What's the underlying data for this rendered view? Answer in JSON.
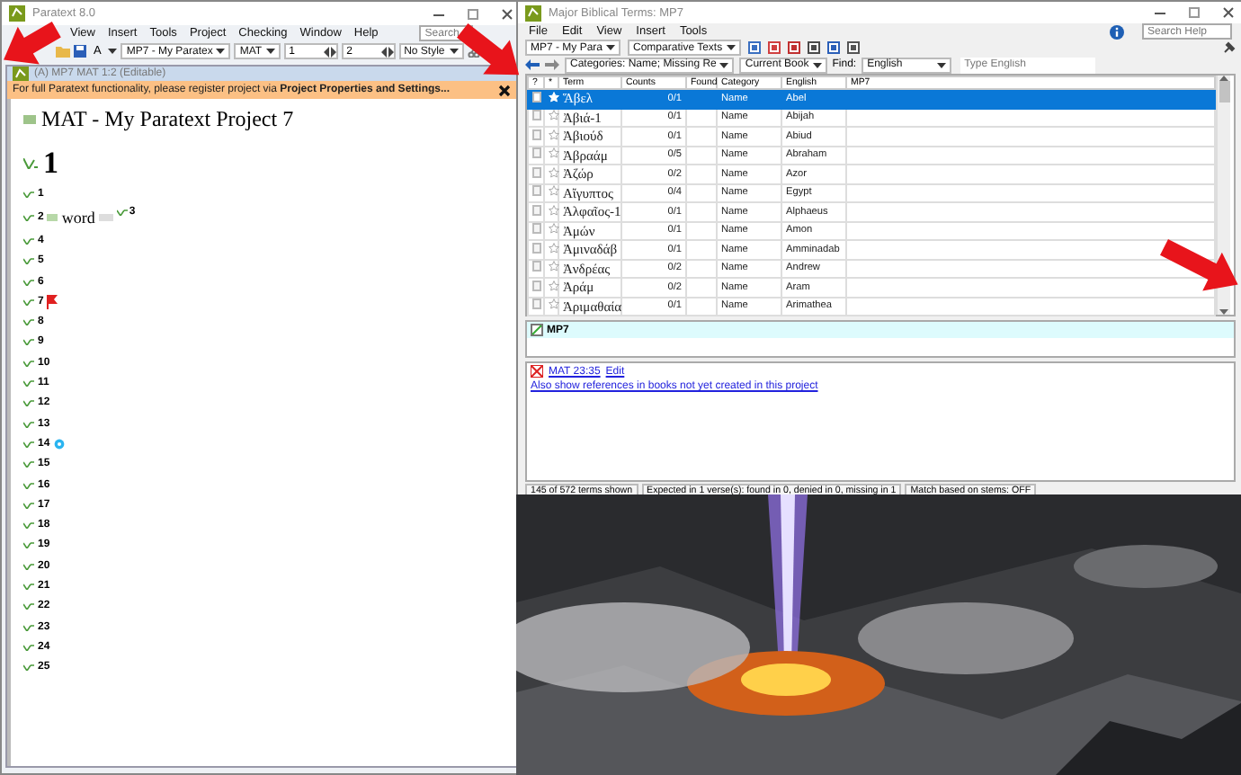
{
  "editor_window": {
    "title": "Paratext 8.0",
    "menu": [
      "View",
      "Insert",
      "Tools",
      "Project",
      "Checking",
      "Window",
      "Help"
    ],
    "search": {
      "placeholder": "Search"
    },
    "toolbar": {
      "style_button": "A",
      "project": "MP7 - My Paratex",
      "book": "MAT",
      "chapter": "1",
      "verse": "2",
      "style": "No Style"
    },
    "document": {
      "title": "(A) MP7 MAT 1:2 (Editable)",
      "banner": "For full Paratext functionality, please register project via **Project Properties and Settings...**",
      "heading": "MAT - My Paratext Project 7",
      "chapter": "1",
      "verses": [
        {
          "number": "1"
        },
        {
          "number": "2",
          "text": "word"
        },
        {
          "number": "3",
          "continues": true
        },
        {
          "number": "4"
        },
        {
          "number": "5"
        },
        {
          "number": "6"
        },
        {
          "number": "7",
          "note": {
            "kind": "flag"
          }
        },
        {
          "number": "8"
        },
        {
          "number": "9"
        },
        {
          "number": "10"
        },
        {
          "number": "11"
        },
        {
          "number": "12"
        },
        {
          "number": "13"
        },
        {
          "number": "14",
          "note": {
            "kind": "comment"
          }
        },
        {
          "number": "15"
        },
        {
          "number": "16"
        },
        {
          "number": "17"
        },
        {
          "number": "18"
        },
        {
          "number": "19"
        },
        {
          "number": "20"
        },
        {
          "number": "21"
        },
        {
          "number": "22"
        },
        {
          "number": "23"
        },
        {
          "number": "24"
        },
        {
          "number": "25"
        }
      ]
    }
  },
  "terms_window": {
    "title": "Major Biblical Terms: MP7",
    "menu": [
      "File",
      "Edit",
      "View",
      "Insert",
      "Tools"
    ],
    "search": {
      "placeholder": "Search Help"
    },
    "toolbar": {
      "project": "MP7 - My Para",
      "texts": "Comparative Texts"
    },
    "filters": {
      "categories": "Categories: Name; Missing Re",
      "scope": "Current Book",
      "find_label": "Find:",
      "find_field": "English",
      "search": {
        "placeholder": "Type English"
      }
    },
    "table": {
      "columns": [
        "?",
        "*",
        "Term",
        "Counts",
        "Found",
        "Category",
        "English",
        "MP7"
      ],
      "rows": [
        {
          "selected": true,
          "term": "Ἅβελ",
          "counts": "0/1",
          "category": "Name",
          "english": "Abel"
        },
        {
          "selected": false,
          "term": "Ἀβιά-1",
          "counts": "0/1",
          "category": "Name",
          "english": "Abijah"
        },
        {
          "selected": false,
          "term": "Ἀβιούδ",
          "counts": "0/1",
          "category": "Name",
          "english": "Abiud"
        },
        {
          "selected": false,
          "term": "Ἀβραάμ",
          "counts": "0/5",
          "category": "Name",
          "english": "Abraham"
        },
        {
          "selected": false,
          "term": "Ἀζώρ",
          "counts": "0/2",
          "category": "Name",
          "english": "Azor"
        },
        {
          "selected": false,
          "term": "Αἴγυπτος",
          "counts": "0/4",
          "category": "Name",
          "english": "Egypt"
        },
        {
          "selected": false,
          "term": "Ἁλφαῖος-1",
          "counts": "0/1",
          "category": "Name",
          "english": "Alphaeus"
        },
        {
          "selected": false,
          "term": "Ἀμών",
          "counts": "0/1",
          "category": "Name",
          "english": "Amon"
        },
        {
          "selected": false,
          "term": "Ἀμιναδάβ",
          "counts": "0/1",
          "category": "Name",
          "english": "Amminadab"
        },
        {
          "selected": false,
          "term": "Ἀνδρέας",
          "counts": "0/2",
          "category": "Name",
          "english": "Andrew"
        },
        {
          "selected": false,
          "term": "Ἀράμ",
          "counts": "0/2",
          "category": "Name",
          "english": "Aram"
        },
        {
          "selected": false,
          "term": "Ἁριμαθαία",
          "counts": "0/1",
          "category": "Name",
          "english": "Arimathea"
        }
      ]
    },
    "renderings": {
      "title": "MP7"
    },
    "references": {
      "reference": "MAT 23:35",
      "edit": "Edit",
      "more": "Also show references in books not yet created in this project"
    },
    "status_bar": [
      "145 of 572 terms shown",
      "Expected in 1 verse(s): found in 0, denied in 0, missing in 1",
      "Match based on stems: OFF"
    ]
  },
  "annotations": [
    {
      "kind": "arrow"
    },
    {
      "kind": "arrow"
    },
    {
      "kind": "arrow"
    }
  ]
}
